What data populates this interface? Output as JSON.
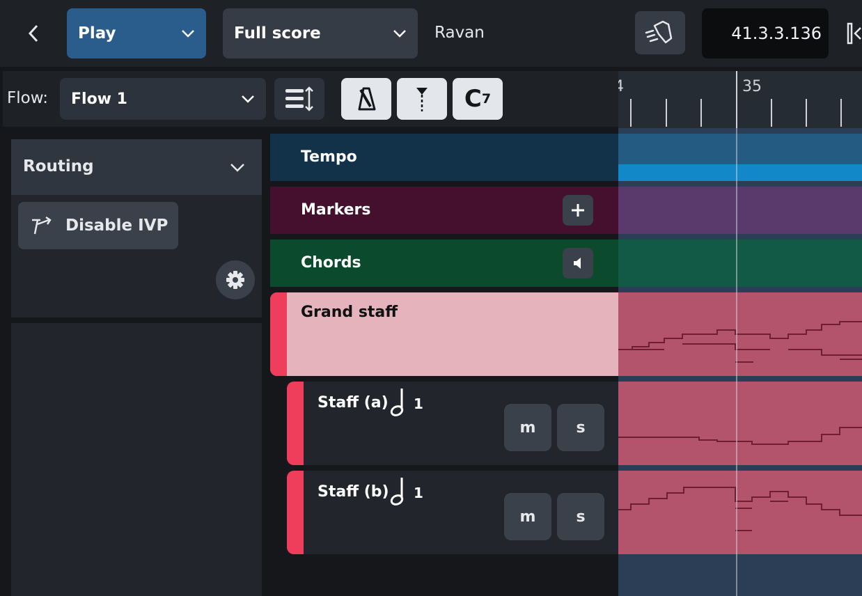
{
  "top": {
    "mode": "Play",
    "layout": "Full score",
    "title": "Ravan",
    "timecode": "41.3.3.136"
  },
  "toolbar": {
    "flow_label": "Flow:",
    "flow_value": "Flow 1",
    "chord_symbol_main": "C",
    "chord_symbol_sup": "7"
  },
  "ruler": {
    "ticks": [
      "4",
      "35"
    ]
  },
  "routing": {
    "title": "Routing",
    "disable_ivp": "Disable IVP"
  },
  "tracks": [
    {
      "name": "Tempo"
    },
    {
      "name": "Markers"
    },
    {
      "name": "Chords"
    },
    {
      "name": "Grand staff"
    },
    {
      "name": "Staff (a)",
      "count": "1",
      "mute": "m",
      "solo": "s"
    },
    {
      "name": "Staff (b)",
      "count": "1",
      "mute": "m",
      "solo": "s"
    }
  ],
  "colors": {
    "accent_blue": "#2a5d8c",
    "tempo": "#12324a",
    "markers": "#45102e",
    "chords": "#0b4a2c",
    "grand_staff": "#e4b3bb",
    "staff_accent": "#ee3e5c"
  }
}
